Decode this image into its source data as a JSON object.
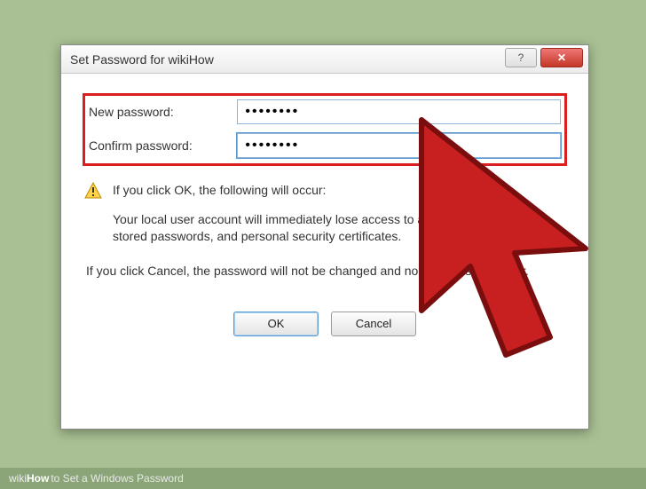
{
  "dialog": {
    "title": "Set Password for wikiHow",
    "labels": {
      "new_password": "New password:",
      "confirm_password": "Confirm password:"
    },
    "values": {
      "new_password": "••••••••",
      "confirm_password": "••••••••"
    },
    "warning_lead": "If you click OK, the following will occur:",
    "warning_body": "Your local user account will immediately lose access to all its encrypted files, stored passwords, and personal security certificates.",
    "cancel_info": "If you click Cancel, the password will not be changed and no data loss will occur.",
    "buttons": {
      "ok": "OK",
      "cancel": "Cancel"
    },
    "titlebar": {
      "help_glyph": "?",
      "close_glyph": "✕"
    }
  },
  "footer": {
    "brand1": "wiki",
    "brand2": "How",
    "article": " to Set a Windows Password"
  }
}
